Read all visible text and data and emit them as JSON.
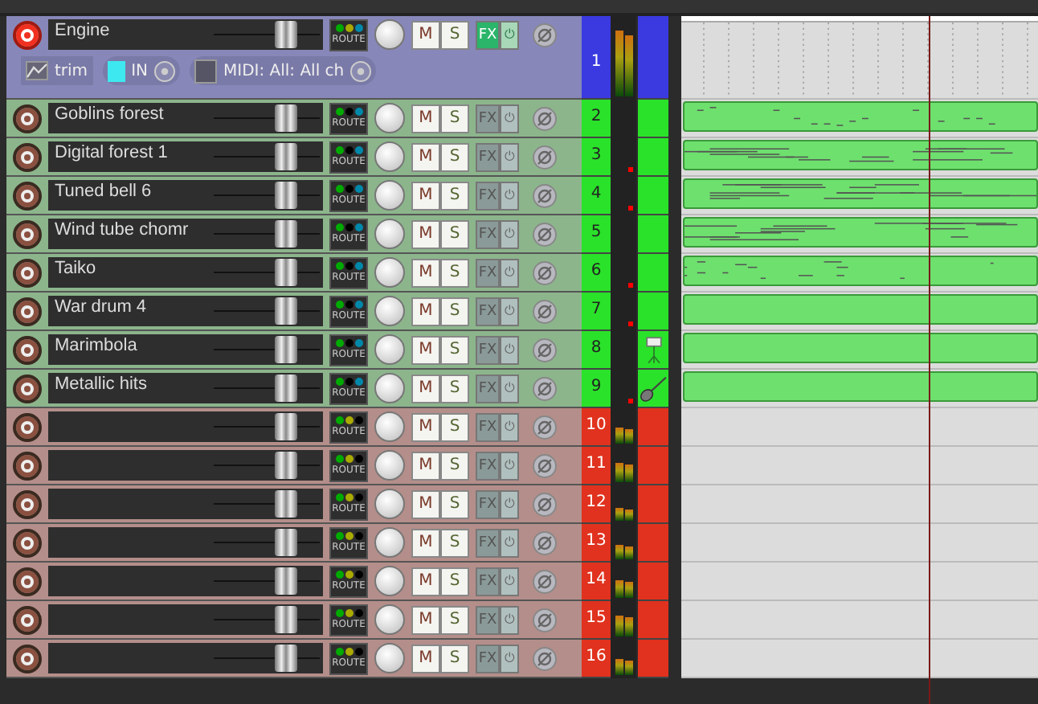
{
  "tracks": [
    {
      "number": "1",
      "name": "Engine",
      "color": "#3a3ae0",
      "selected": true,
      "armed": true,
      "fx_active": true,
      "level": 0.85,
      "peak_marker": false,
      "has_item": false,
      "buttons": {
        "route": "ROUTE",
        "mute": "M",
        "solo": "S",
        "fx": "FX",
        "power": "⏻"
      },
      "input": {
        "trim": "trim",
        "in": "IN",
        "midi": "MIDI: All: All ch"
      }
    },
    {
      "number": "2",
      "name": "Goblins forest",
      "color": "#2ae22a",
      "selected": false,
      "armed": false,
      "fx_active": false,
      "peak_marker": false,
      "has_item": true,
      "buttons": {
        "route": "ROUTE",
        "mute": "M",
        "solo": "S",
        "fx": "FX",
        "power": "⏻"
      }
    },
    {
      "number": "3",
      "name": "Digital forest 1",
      "color": "#2ae22a",
      "selected": false,
      "armed": false,
      "fx_active": false,
      "peak_marker": true,
      "has_item": true,
      "buttons": {
        "route": "ROUTE",
        "mute": "M",
        "solo": "S",
        "fx": "FX",
        "power": "⏻"
      }
    },
    {
      "number": "4",
      "name": "Tuned bell 6",
      "color": "#2ae22a",
      "selected": false,
      "armed": false,
      "fx_active": false,
      "peak_marker": true,
      "has_item": true,
      "buttons": {
        "route": "ROUTE",
        "mute": "M",
        "solo": "S",
        "fx": "FX",
        "power": "⏻"
      }
    },
    {
      "number": "5",
      "name": "Wind tube chomr",
      "color": "#2ae22a",
      "selected": false,
      "armed": false,
      "fx_active": false,
      "peak_marker": false,
      "has_item": true,
      "buttons": {
        "route": "ROUTE",
        "mute": "M",
        "solo": "S",
        "fx": "FX",
        "power": "⏻"
      }
    },
    {
      "number": "6",
      "name": "Taiko",
      "color": "#2ae22a",
      "selected": false,
      "armed": false,
      "fx_active": false,
      "peak_marker": true,
      "has_item": true,
      "buttons": {
        "route": "ROUTE",
        "mute": "M",
        "solo": "S",
        "fx": "FX",
        "power": "⏻"
      }
    },
    {
      "number": "7",
      "name": "War drum 4",
      "color": "#2ae22a",
      "selected": false,
      "armed": false,
      "fx_active": false,
      "peak_marker": true,
      "has_item": true,
      "buttons": {
        "route": "ROUTE",
        "mute": "M",
        "solo": "S",
        "fx": "FX",
        "power": "⏻"
      }
    },
    {
      "number": "8",
      "name": "Marimbola",
      "kind": "drum",
      "color": "#2ae22a",
      "selected": false,
      "armed": false,
      "fx_active": false,
      "peak_marker": false,
      "has_item": true,
      "buttons": {
        "route": "ROUTE",
        "mute": "M",
        "solo": "S",
        "fx": "FX",
        "power": "⏻"
      }
    },
    {
      "number": "9",
      "name": "Metallic hits",
      "kind": "guitar",
      "color": "#2ae22a",
      "selected": false,
      "armed": false,
      "fx_active": false,
      "peak_marker": true,
      "has_item": true,
      "buttons": {
        "route": "ROUTE",
        "mute": "M",
        "solo": "S",
        "fx": "FX",
        "power": "⏻"
      }
    },
    {
      "number": "10",
      "color": "#e0321e",
      "selected": false,
      "armed": false,
      "fx_active": false,
      "level": 0.5,
      "peak_marker": false,
      "has_item": false,
      "buttons": {
        "route": "ROUTE",
        "mute": "M",
        "solo": "S",
        "fx": "FX",
        "power": "⏻"
      }
    },
    {
      "number": "11",
      "color": "#e0321e",
      "selected": false,
      "armed": false,
      "fx_active": false,
      "level": 0.6,
      "peak_marker": false,
      "has_item": false,
      "buttons": {
        "route": "ROUTE",
        "mute": "M",
        "solo": "S",
        "fx": "FX",
        "power": "⏻"
      }
    },
    {
      "number": "12",
      "color": "#e0321e",
      "selected": false,
      "armed": false,
      "fx_active": false,
      "level": 0.4,
      "peak_marker": false,
      "has_item": false,
      "buttons": {
        "route": "ROUTE",
        "mute": "M",
        "solo": "S",
        "fx": "FX",
        "power": "⏻"
      }
    },
    {
      "number": "13",
      "color": "#e0321e",
      "selected": false,
      "armed": false,
      "fx_active": false,
      "level": 0.45,
      "peak_marker": false,
      "has_item": false,
      "buttons": {
        "route": "ROUTE",
        "mute": "M",
        "solo": "S",
        "fx": "FX",
        "power": "⏻"
      }
    },
    {
      "number": "14",
      "color": "#e0321e",
      "selected": false,
      "armed": false,
      "fx_active": false,
      "level": 0.55,
      "peak_marker": false,
      "has_item": false,
      "buttons": {
        "route": "ROUTE",
        "mute": "M",
        "solo": "S",
        "fx": "FX",
        "power": "⏻"
      }
    },
    {
      "number": "15",
      "color": "#e0321e",
      "selected": false,
      "armed": false,
      "fx_active": false,
      "level": 0.65,
      "peak_marker": false,
      "has_item": false,
      "buttons": {
        "route": "ROUTE",
        "mute": "M",
        "solo": "S",
        "fx": "FX",
        "power": "⏻"
      }
    },
    {
      "number": "16",
      "color": "#e0321e",
      "selected": false,
      "armed": false,
      "fx_active": false,
      "level": 0.5,
      "peak_marker": false,
      "has_item": false,
      "buttons": {
        "route": "ROUTE",
        "mute": "M",
        "solo": "S",
        "fx": "FX",
        "power": "⏻"
      }
    }
  ]
}
